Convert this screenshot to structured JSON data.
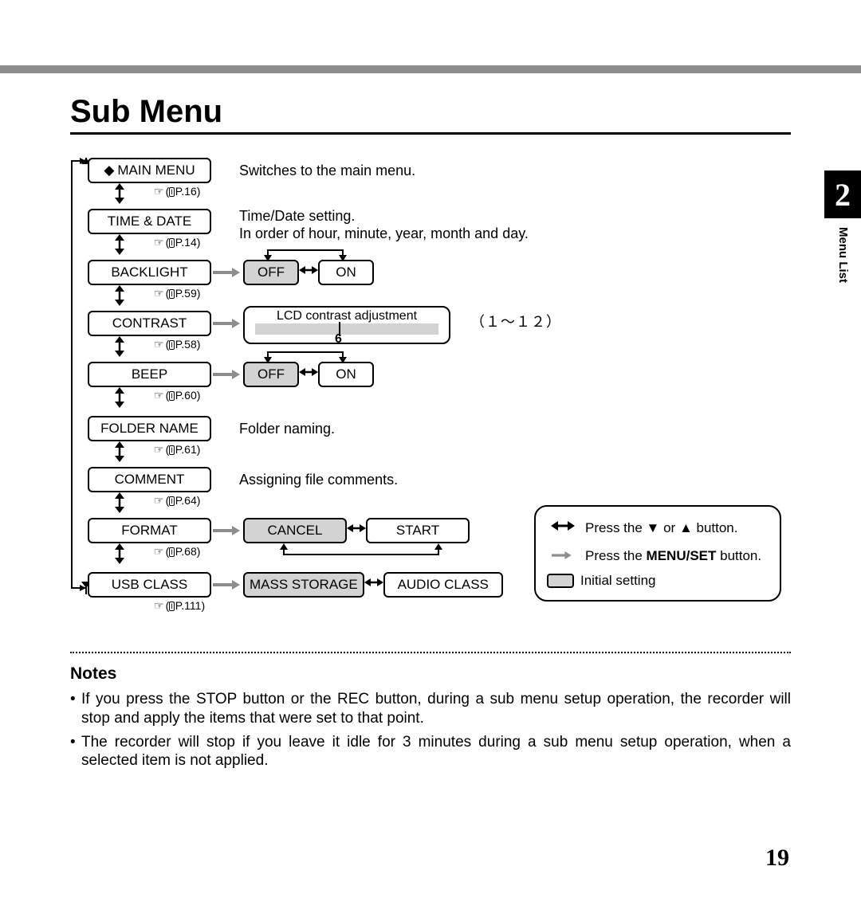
{
  "title": "Sub Menu",
  "chapter_number": "2",
  "chapter_label": "Menu List",
  "menu": {
    "main_menu": {
      "label": "MAIN MENU",
      "page_ref": "P.16",
      "desc": "Switches to the main menu."
    },
    "time_date": {
      "label": "TIME & DATE",
      "page_ref": "P.14",
      "desc_line1": "Time/Date setting.",
      "desc_line2": "In order of hour, minute, year, month and day."
    },
    "backlight": {
      "label": "BACKLIGHT",
      "page_ref": "P.59",
      "options": {
        "off": "OFF",
        "on": "ON"
      },
      "initial": "off"
    },
    "contrast": {
      "label": "CONTRAST",
      "page_ref": "P.58",
      "desc": "LCD contrast adjustment",
      "value_label": "6",
      "range": "（１～１２）"
    },
    "beep": {
      "label": "BEEP",
      "page_ref": "P.60",
      "options": {
        "off": "OFF",
        "on": "ON"
      },
      "initial": "off"
    },
    "folder_name": {
      "label": "FOLDER NAME",
      "page_ref": "P.61",
      "desc": "Folder naming."
    },
    "comment": {
      "label": "COMMENT",
      "page_ref": "P.64",
      "desc": "Assigning file comments."
    },
    "format": {
      "label": "FORMAT",
      "page_ref": "P.68",
      "options": {
        "cancel": "CANCEL",
        "start": "START"
      },
      "initial": "cancel"
    },
    "usb_class": {
      "label": "USB CLASS",
      "page_ref": "P.111",
      "options": {
        "mass": "MASS STORAGE",
        "audio": "AUDIO CLASS"
      },
      "initial": "mass"
    }
  },
  "legend": {
    "updown_pre": "Press the ",
    "updown_post": " button.",
    "menuset_pre": "Press the ",
    "menuset_bold": "MENU/SET",
    "menuset_post": " button.",
    "initial": "Initial setting",
    "or": " or "
  },
  "notes": {
    "heading": "Notes",
    "items": [
      "If you press the STOP button or the REC button, during a sub menu setup operation, the recorder will stop and apply the items that were set to that point.",
      "The recorder will stop if you leave it idle for 3 minutes during a sub menu setup operation, when a selected item is not applied."
    ]
  },
  "page_number": "19"
}
